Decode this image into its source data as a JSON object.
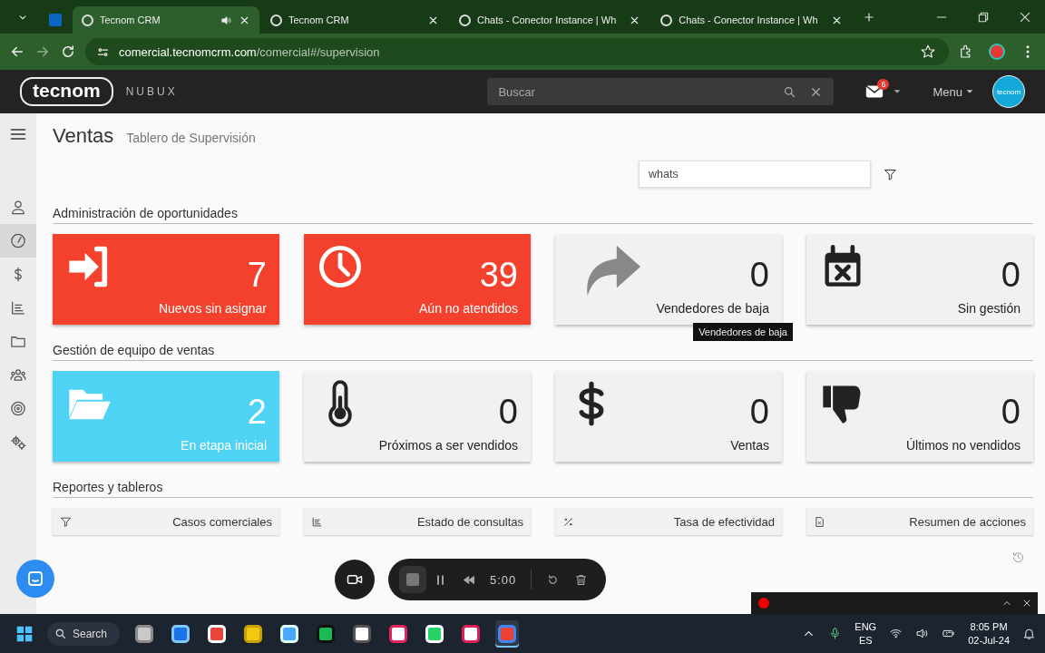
{
  "browser": {
    "tabs": [
      {
        "kind": "pinned",
        "selected": false
      },
      {
        "kind": "app",
        "title": "Tecnom CRM",
        "selected": true,
        "audio": true
      },
      {
        "kind": "app",
        "title": "Tecnom CRM",
        "selected": false,
        "audio": false
      },
      {
        "kind": "chat",
        "title": "Chats - Conector Instance | Wh",
        "selected": false,
        "audio": false
      },
      {
        "kind": "chat",
        "title": "Chats - Conector Instance | Wh",
        "selected": false,
        "audio": false
      }
    ],
    "url": {
      "domain": "comercial.tecnomcrm.com",
      "path": "/comercial#/supervision"
    }
  },
  "header": {
    "logo": "tecnom",
    "brand": "NUBUX",
    "search_placeholder": "Buscar",
    "mail_badge": "6",
    "menu": "Menu",
    "avatar": "tecnom"
  },
  "sidebar": {
    "items": [
      {
        "kind": "user",
        "selected": false
      },
      {
        "kind": "gauge",
        "selected": true
      },
      {
        "kind": "dollar",
        "selected": false
      },
      {
        "kind": "chart",
        "selected": false
      },
      {
        "kind": "folder",
        "selected": false
      },
      {
        "kind": "team",
        "selected": false
      },
      {
        "kind": "target",
        "selected": false
      },
      {
        "kind": "gears",
        "selected": false
      }
    ]
  },
  "page": {
    "title": "Ventas",
    "subtitle": "Tablero de Supervisión",
    "filter_value": "whats"
  },
  "sections": [
    {
      "title": "Administración de oportunidades",
      "cards": [
        {
          "value": "7",
          "label": "Nuevos sin asignar",
          "color": "#f4412d"
        },
        {
          "value": "39",
          "label": "Aún no atendidos",
          "color": "#f4412d"
        },
        {
          "value": "0",
          "label": "Vendedores de baja",
          "color": "#f1f1f1",
          "tooltip": "Vendedores de baja"
        },
        {
          "value": "0",
          "label": "Sin gestión",
          "color": "#f1f1f1"
        }
      ]
    },
    {
      "title": "Gestión de equipo de ventas",
      "cards": [
        {
          "value": "2",
          "label": "En etapa inicial",
          "color": "#4fd3f5"
        },
        {
          "value": "0",
          "label": "Próximos a ser vendidos",
          "color": "#f1f1f1"
        },
        {
          "value": "0",
          "label": "Ventas",
          "color": "#f1f1f1"
        },
        {
          "value": "0",
          "label": "Últimos no vendidos",
          "color": "#f1f1f1"
        }
      ]
    },
    {
      "title": "Reportes y tableros",
      "reports": [
        {
          "label": "Casos comerciales"
        },
        {
          "label": "Estado de consultas"
        },
        {
          "label": "Tasa de efectividad"
        },
        {
          "label": "Resumen de acciones"
        }
      ]
    }
  ],
  "recorder": {
    "time": "5:00"
  },
  "taskbar": {
    "search": "Search",
    "apps": [
      {
        "kind": "files",
        "selected": false
      },
      {
        "kind": "mail",
        "selected": false
      },
      {
        "kind": "todo",
        "selected": false
      },
      {
        "kind": "powerbi",
        "selected": false
      },
      {
        "kind": "notepad",
        "selected": false
      },
      {
        "kind": "spotify",
        "selected": false
      },
      {
        "kind": "key",
        "selected": false
      },
      {
        "kind": "snip",
        "selected": false
      },
      {
        "kind": "whatsapp",
        "selected": false
      },
      {
        "kind": "slack",
        "selected": false
      },
      {
        "kind": "chrome",
        "selected": true
      }
    ],
    "lang": "ENG",
    "layout": "ES",
    "time": "8:05 PM",
    "date": "02-Jul-24"
  }
}
